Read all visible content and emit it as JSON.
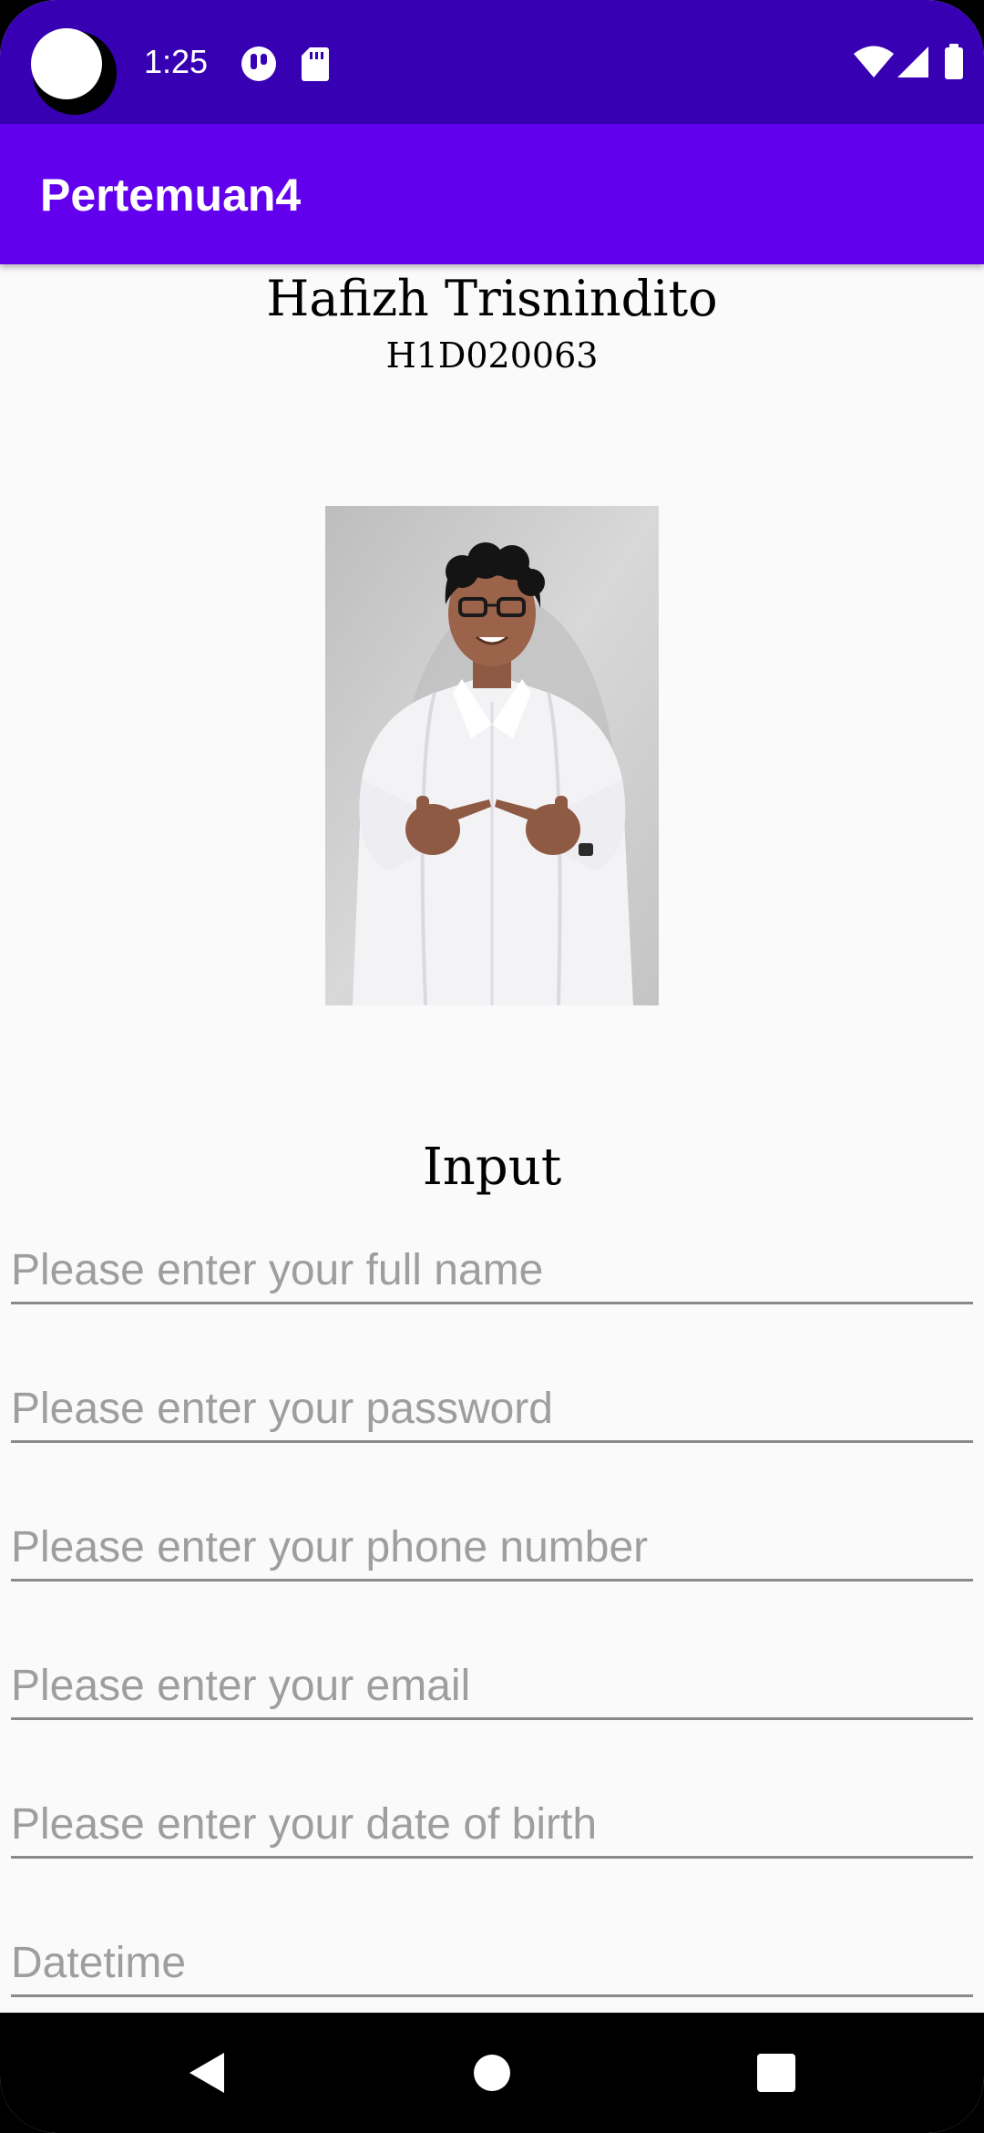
{
  "status_bar": {
    "time": "1:25",
    "icons": [
      "camera-cutout-icon",
      "notification-app-icon",
      "sd-card-icon",
      "wifi-icon",
      "cellular-signal-icon",
      "battery-icon"
    ],
    "background": "#3700b3"
  },
  "app_bar": {
    "title": "Pertemuan4",
    "background": "#6200ee"
  },
  "profile": {
    "name": "Hafizh Trisnindito",
    "nim": "H1D020063",
    "photo": "person-photo"
  },
  "form": {
    "title": "Input",
    "fields": [
      {
        "placeholder": "Please enter your full name",
        "value": ""
      },
      {
        "placeholder": "Please enter your password",
        "value": ""
      },
      {
        "placeholder": "Please enter your phone number",
        "value": ""
      },
      {
        "placeholder": "Please enter your email",
        "value": ""
      },
      {
        "placeholder": "Please enter your date of birth",
        "value": ""
      },
      {
        "placeholder": "Datetime",
        "value": ""
      }
    ]
  },
  "nav_bar": {
    "buttons": [
      "back-icon",
      "home-icon",
      "recents-icon"
    ]
  }
}
